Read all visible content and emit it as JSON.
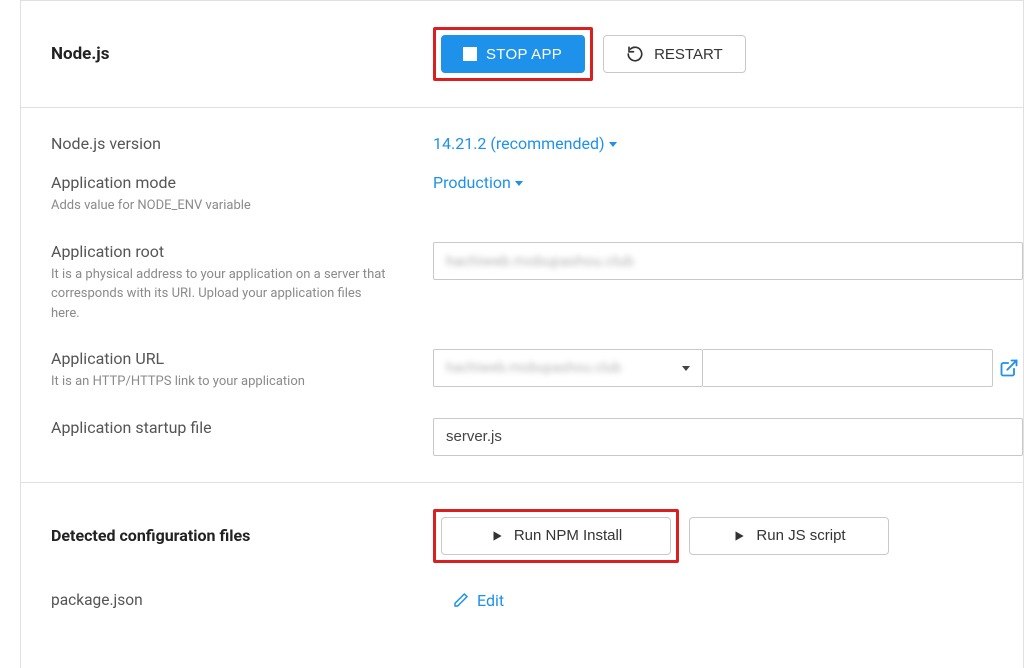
{
  "header": {
    "title": "Node.js",
    "stop_label": "STOP APP",
    "restart_label": "RESTART"
  },
  "fields": {
    "version": {
      "label": "Node.js version",
      "value": "14.21.2 (recommended)"
    },
    "app_mode": {
      "label": "Application mode",
      "hint": "Adds value for NODE_ENV variable",
      "value": "Production"
    },
    "app_root": {
      "label": "Application root",
      "hint": "It is a physical address to your application on a server that corresponds with its URI. Upload your application files here.",
      "value": "hachiweb.mobupashou.club"
    },
    "app_url": {
      "label": "Application URL",
      "hint": "It is an HTTP/HTTPS link to your application",
      "selected": "hachiweb.mobupashou.club"
    },
    "startup": {
      "label": "Application startup file",
      "value": "server.js"
    }
  },
  "config": {
    "title": "Detected configuration files",
    "npm_label": "Run NPM Install",
    "js_label": "Run JS script",
    "file": "package.json",
    "edit_label": "Edit"
  }
}
